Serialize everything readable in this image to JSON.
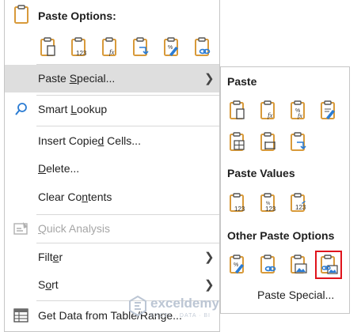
{
  "menu": {
    "paste_options_header": "Paste Options:",
    "items": [
      {
        "pre": "Paste ",
        "u": "S",
        "post": "pecial..."
      },
      {
        "pre": "Smart ",
        "u": "L",
        "post": "ookup"
      },
      {
        "pre": "Insert Copie",
        "u": "d",
        "post": " Cells..."
      },
      {
        "pre": "",
        "u": "D",
        "post": "elete..."
      },
      {
        "pre": "Clear Co",
        "u": "n",
        "post": "tents"
      },
      {
        "pre": "",
        "u": "Q",
        "post": "uick Analysis"
      },
      {
        "pre": "Filt",
        "u": "e",
        "post": "r"
      },
      {
        "pre": "S",
        "u": "o",
        "post": "rt"
      },
      {
        "pre": "Get Data from Table/Range...",
        "u": "",
        "post": ""
      }
    ],
    "paste_icons": [
      "paste-icon",
      "paste-values-icon",
      "paste-formulas-icon",
      "paste-transpose-icon",
      "paste-formatting-icon",
      "paste-link-icon"
    ]
  },
  "submenu": {
    "paste_header": "Paste",
    "paste_values_header": "Paste Values",
    "other_header": "Other Paste Options",
    "paste_special": "Paste Special...",
    "paste_icons": [
      "paste-icon",
      "paste-formulas-icon",
      "paste-formulas-number-format-icon",
      "paste-keep-source-formatting-icon",
      "paste-no-borders-icon",
      "paste-keep-column-widths-icon",
      "paste-transpose-icon"
    ],
    "value_icons": [
      "paste-values-icon",
      "paste-values-number-format-icon",
      "paste-values-source-formatting-icon"
    ],
    "other_icons": [
      "paste-formatting-icon",
      "paste-link-icon",
      "paste-picture-icon",
      "paste-linked-picture-icon"
    ],
    "selected_icon": "paste-linked-picture-icon"
  },
  "watermark": {
    "name": "exceldemy",
    "tagline": "EXCEL · DATA · BI"
  },
  "colors": {
    "accent": "#2b7cd3",
    "clipboard": "#d89a3a",
    "highlight": "#dedede",
    "selection": "#e0141c"
  }
}
